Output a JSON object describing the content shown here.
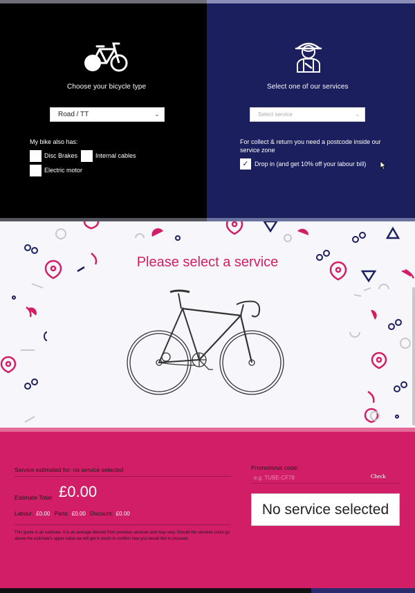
{
  "bike_panel": {
    "title": "Choose your bicycle type",
    "bike_type_value": "Road / TT",
    "also_has_label": "My bike also has:",
    "options": {
      "disc_brakes": "Disc Brakes",
      "internal_cables": "Internal cables",
      "electric_motor": "Electric motor"
    }
  },
  "service_panel": {
    "title": "Select one of our services",
    "select_placeholder": "Select service",
    "collect_text": "For collect & return you need a postcode inside our service zone",
    "drop_in_label": "Drop in (and get 10% off your labour bill)",
    "drop_in_checked": true
  },
  "middle": {
    "title": "Please select a service"
  },
  "estimate": {
    "service_for": "Service estimated for: no service selected",
    "total_label": "Estimate Total:",
    "total_value": "£0.00",
    "labour_label": "Labour:",
    "labour_value": "£0.00",
    "parts_label": "Parts:",
    "parts_value": "£0.00",
    "discount_label": "Discount:",
    "discount_value": "£0.00",
    "disclaimer": "This quote is an estimate. It is an average derived from previous services and may vary. Should the services costs go above the estimate's upper value we will get in touch to confirm how you would like to proceed."
  },
  "promo": {
    "label": "Promotional code:",
    "placeholder": "e.g. TUBE-CF78",
    "check_label": "Check"
  },
  "summary": {
    "text": "No service selected"
  },
  "colors": {
    "left_panel": "#000000",
    "right_panel": "#1b1f5e",
    "accent_pink": "#d11e66",
    "navy": "#1b1f5e"
  }
}
